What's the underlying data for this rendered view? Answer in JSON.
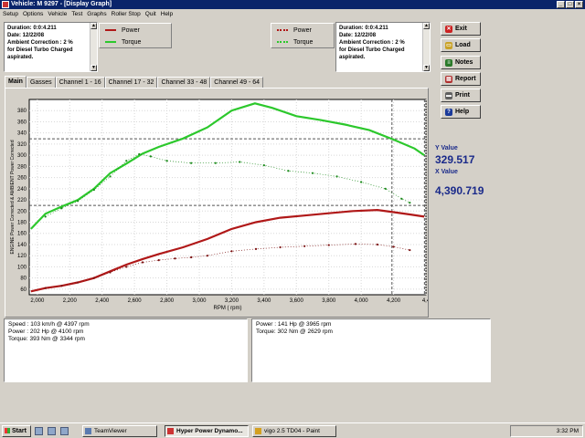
{
  "window": {
    "title": "Vehicle: M 9297 - [Display Graph]"
  },
  "menu": [
    "Setup",
    "Options",
    "Vehicle",
    "Test",
    "Graphs",
    "Roller Stop",
    "Quit",
    "Help"
  ],
  "info_left": {
    "lines": [
      "Duration: 0:0:4.211",
      "Date: 12/22/08",
      "Ambient Correction : 2 %",
      "  for Diesel Turbo Charged",
      "aspirated."
    ]
  },
  "info_right": {
    "lines": [
      "Duration: 0:0:4.211",
      "Date: 12/22/08",
      "Ambient Correction : 2 %",
      "  for Diesel Turbo Charged",
      "aspirated."
    ]
  },
  "legend_left": {
    "power": "Power",
    "torque": "Torque"
  },
  "legend_right": {
    "power": "Power",
    "torque": "Torque"
  },
  "buttons": {
    "exit": "Exit",
    "load": "Load",
    "notes": "Notes",
    "report": "Report",
    "print": "Print",
    "help": "Help"
  },
  "tabs": [
    "Main",
    "Gasses",
    "Channel 1 - 16",
    "Channel 17 - 32",
    "Channel 33 - 48",
    "Channel 49 - 64"
  ],
  "readout": {
    "y_label": "Y Value",
    "y_value": "329.517",
    "x_label": "X Value",
    "x_value": "4,390.719"
  },
  "bottom_left": {
    "lines": [
      "Speed : 103 km/h @ 4397 rpm",
      "Power : 202 Hp @ 4100 rpm",
      "Torque: 393 Nm @ 3344 rpm"
    ]
  },
  "bottom_right": {
    "lines": [
      "Power : 141 Hp @ 3965 rpm",
      "Torque: 302 Nm @ 2629 rpm"
    ]
  },
  "taskbar": {
    "start": "Start",
    "items": [
      "TeamViewer",
      "Hyper Power Dynamo...",
      "vigo 2.5 TD04 - Paint"
    ],
    "clock": "3:32 PM"
  },
  "colors": {
    "power_solid": "#b01818",
    "torque_solid": "#2cc82c",
    "power_dotted": "#7a1010",
    "torque_dotted": "#1a8a1a"
  },
  "chart_data": {
    "type": "line",
    "xlabel": "RPM ( rpm)",
    "ylabel": "ENGINE Power Corrected & AMBIENT Power Corrected",
    "xlim": [
      1950,
      4400
    ],
    "ylim": [
      50,
      400
    ],
    "x_ticks": [
      "2,000",
      "2,200",
      "2,400",
      "2,600",
      "2,800",
      "3,000",
      "3,200",
      "3,400",
      "3,600",
      "3,800",
      "4,000",
      "4,200",
      "4,4"
    ],
    "x_tick_values": [
      2000,
      2200,
      2400,
      2600,
      2800,
      3000,
      3200,
      3400,
      3600,
      3800,
      4000,
      4200,
      4400
    ],
    "y_ticks": [
      60,
      80,
      100,
      120,
      140,
      160,
      180,
      200,
      220,
      240,
      260,
      280,
      300,
      320,
      340,
      360,
      380
    ],
    "crosshair": {
      "x": 4390.719,
      "y": 329.517,
      "vline2": 4190,
      "hline2": 210
    },
    "series": [
      {
        "name": "Torque",
        "style": "solid",
        "color": "#2cc82c",
        "x": [
          1960,
          2050,
          2150,
          2250,
          2350,
          2450,
          2550,
          2650,
          2750,
          2900,
          3050,
          3200,
          3344,
          3450,
          3600,
          3750,
          3900,
          4050,
          4200,
          4330,
          4390
        ],
        "y": [
          168,
          195,
          208,
          220,
          240,
          268,
          285,
          303,
          315,
          330,
          350,
          380,
          393,
          385,
          370,
          363,
          355,
          345,
          328,
          312,
          300
        ]
      },
      {
        "name": "Torque",
        "style": "dotted",
        "color": "#1a8a1a",
        "x": [
          2050,
          2150,
          2250,
          2350,
          2450,
          2550,
          2629,
          2700,
          2800,
          2950,
          3100,
          3250,
          3400,
          3550,
          3700,
          3850,
          4000,
          4150,
          4250,
          4300
        ],
        "y": [
          190,
          205,
          218,
          238,
          262,
          290,
          302,
          298,
          290,
          286,
          286,
          288,
          282,
          272,
          268,
          262,
          252,
          240,
          222,
          215
        ]
      },
      {
        "name": "Power",
        "style": "solid",
        "color": "#b01818",
        "x": [
          1960,
          2050,
          2150,
          2250,
          2350,
          2450,
          2550,
          2650,
          2750,
          2900,
          3050,
          3200,
          3350,
          3500,
          3650,
          3800,
          3950,
          4100,
          4200,
          4300,
          4390
        ],
        "y": [
          56,
          62,
          66,
          72,
          80,
          92,
          104,
          114,
          123,
          135,
          150,
          168,
          180,
          188,
          192,
          196,
          200,
          202,
          198,
          194,
          190
        ]
      },
      {
        "name": "Power",
        "style": "dotted",
        "color": "#7a1010",
        "x": [
          2050,
          2150,
          2250,
          2350,
          2450,
          2550,
          2650,
          2750,
          2850,
          2950,
          3050,
          3200,
          3350,
          3500,
          3650,
          3800,
          3965,
          4100,
          4200,
          4300
        ],
        "y": [
          62,
          66,
          72,
          80,
          90,
          100,
          108,
          112,
          115,
          117,
          120,
          128,
          132,
          135,
          137,
          139,
          141,
          140,
          136,
          130
        ]
      }
    ]
  }
}
